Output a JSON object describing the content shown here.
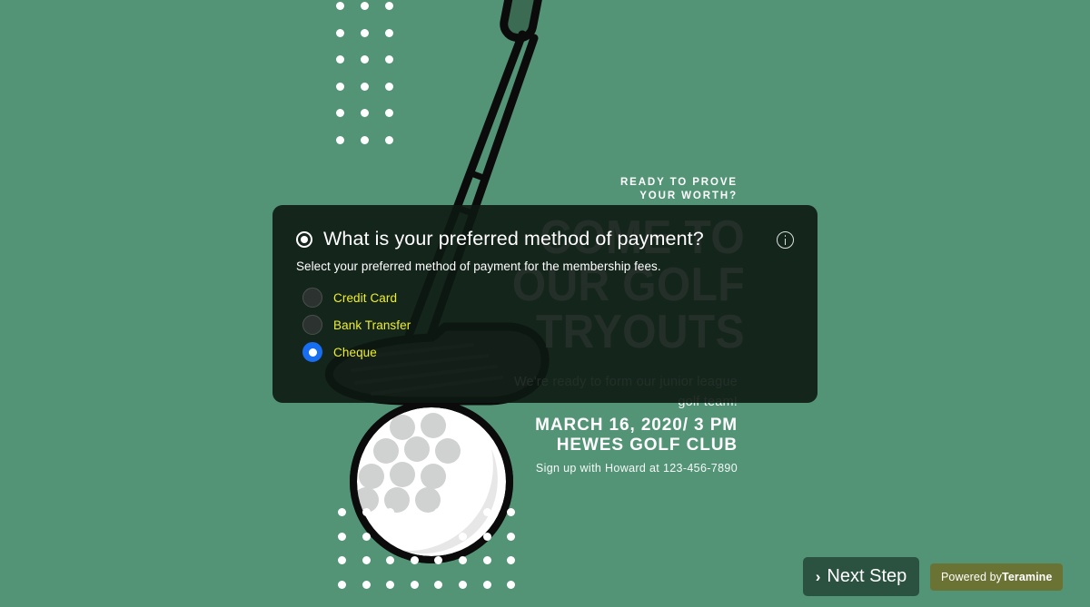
{
  "theme": {
    "background_green": "#539477",
    "modal_background": "#0d1812",
    "option_label_color": "#f0f028",
    "selected_radio_color": "#186ef0",
    "next_button_color": "#2b5240",
    "powered_badge_color": "#6b7334"
  },
  "poster": {
    "kicker": "READY TO PROVE\nYOUR WORTH?",
    "kicker_line1": "READY TO PROVE",
    "kicker_line2": "YOUR WORTH?",
    "headline_line1": "COME TO",
    "headline_line2": "OUR GOLF",
    "headline_line3": "TRYOUTS",
    "subtitle": "We're ready to form our junior league golf team!",
    "date_line": "MARCH 16, 2020/ 3 PM",
    "venue_line": "HEWES GOLF CLUB",
    "signup": "Sign up with Howard at 123-456-7890"
  },
  "modal": {
    "question_icon": "radio-button-icon",
    "title": "What is your preferred method of payment?",
    "description": "Select your preferred method of payment for the membership fees.",
    "info_icon": "info-icon",
    "options": [
      {
        "label": "Credit Card",
        "selected": false
      },
      {
        "label": "Bank Transfer",
        "selected": false
      },
      {
        "label": "Cheque",
        "selected": true
      }
    ]
  },
  "footer": {
    "next_chevron": "›",
    "next_label": "Next Step",
    "powered_prefix": "Powered by",
    "powered_brand": "Teramine"
  }
}
